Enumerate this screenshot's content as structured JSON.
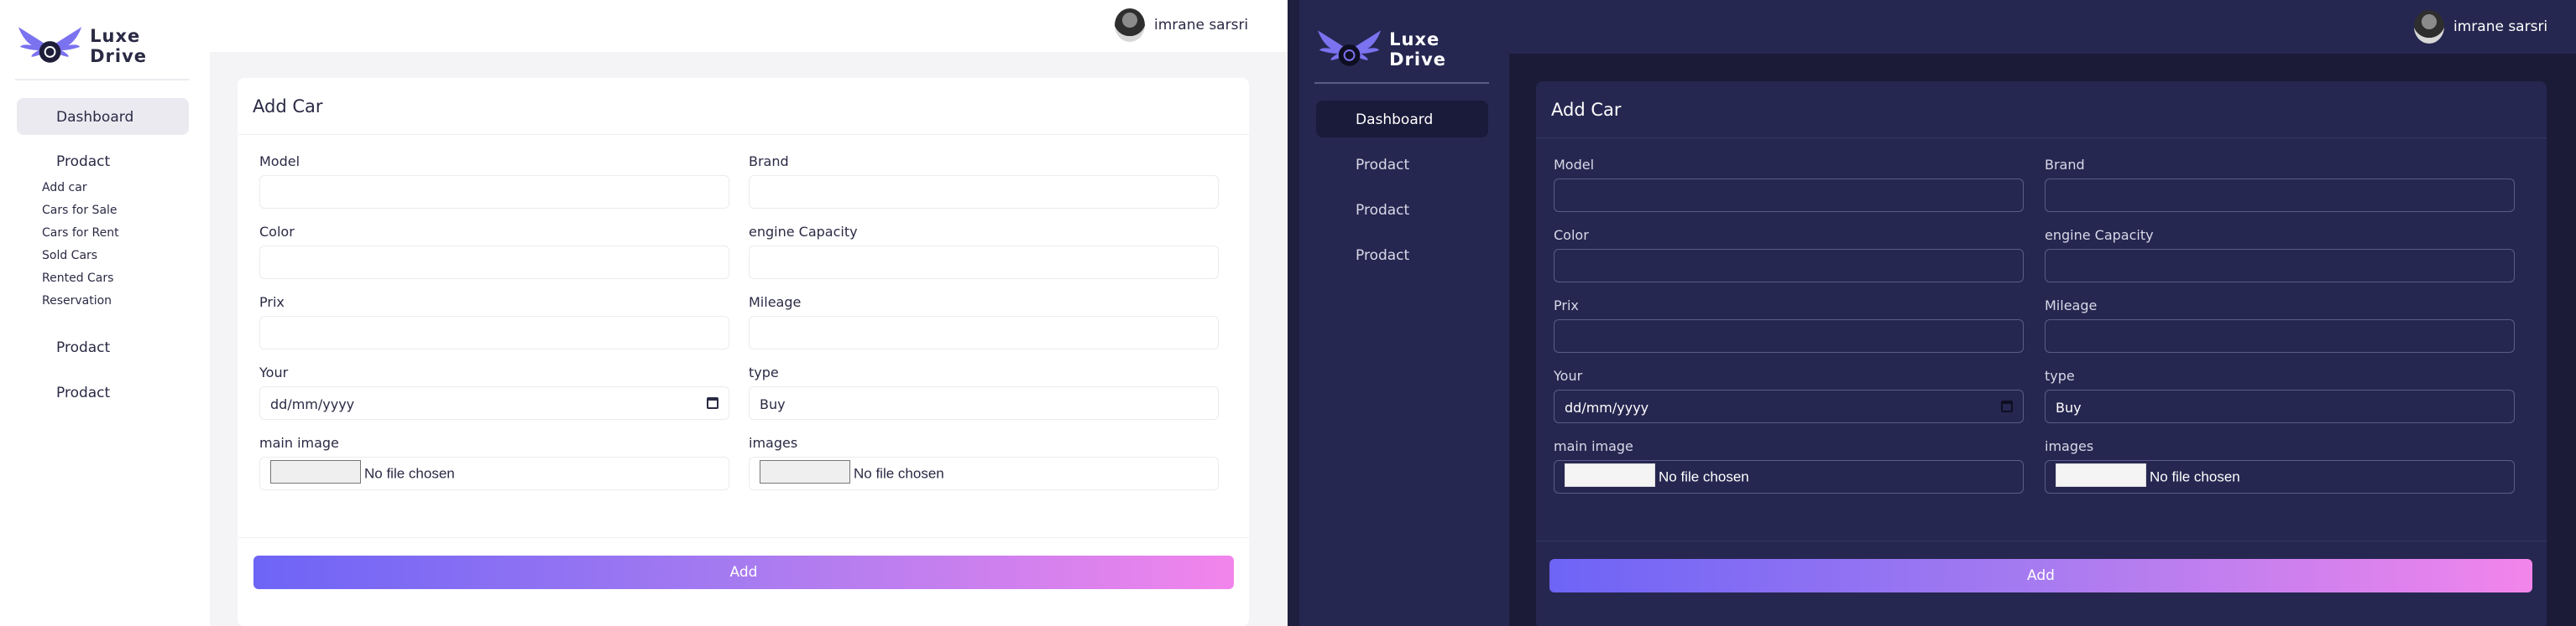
{
  "brand": {
    "name": "Luxe Drive"
  },
  "user": {
    "name": "imrane sarsri"
  },
  "sidebar": {
    "dashboard": "Dashboard",
    "product_label": "Prodact",
    "light_subitems": [
      "Add car",
      "Cars for Sale",
      "Cars for Rent",
      "Sold Cars",
      "Rented Cars",
      "Reservation"
    ]
  },
  "form": {
    "title": "Add Car",
    "labels": {
      "model": "Model",
      "brand": "Brand",
      "color": "Color",
      "engine": "engine Capacity",
      "prix": "Prix",
      "mileage": "Mileage",
      "date": "Your",
      "type": "type",
      "main_image": "main image",
      "images": "images"
    },
    "date_placeholder": "dd/mm/yyyy",
    "type_value": "Buy",
    "no_file": "No file chosen",
    "submit": "Add"
  },
  "colors": {
    "accent_start": "#6d64f6",
    "accent_end": "#f285ec",
    "dark_bg": "#1b1b38",
    "dark_panel": "#262750"
  }
}
